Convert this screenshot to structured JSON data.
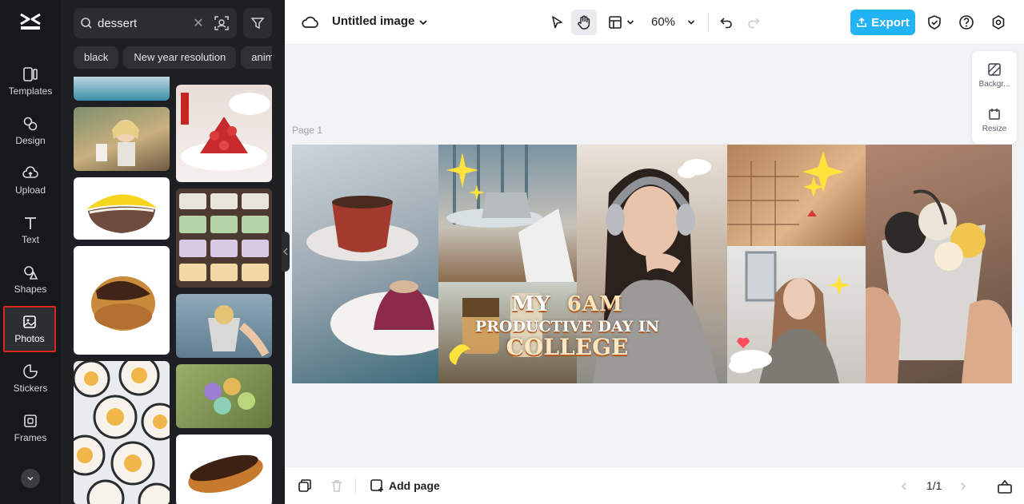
{
  "sidebar": {
    "items": [
      {
        "label": "Templates",
        "icon": "templates-icon"
      },
      {
        "label": "Design",
        "icon": "design-icon"
      },
      {
        "label": "Upload",
        "icon": "upload-icon"
      },
      {
        "label": "Text",
        "icon": "text-icon"
      },
      {
        "label": "Shapes",
        "icon": "shapes-icon"
      },
      {
        "label": "Photos",
        "icon": "photos-icon",
        "active": true
      },
      {
        "label": "Stickers",
        "icon": "stickers-icon"
      },
      {
        "label": "Frames",
        "icon": "frames-icon"
      }
    ]
  },
  "panel": {
    "search": {
      "value": "dessert"
    },
    "chips": [
      "black",
      "New year resolution",
      "anim"
    ]
  },
  "topbar": {
    "doc_title": "Untitled image",
    "zoom": "60%",
    "export_label": "Export"
  },
  "canvas": {
    "page_label": "Page 1",
    "headline": {
      "line1_a": "MY",
      "line1_b": "6AM",
      "line2": "PRODUCTIVE DAY IN",
      "line3": "COLLEGE"
    }
  },
  "side_tools": {
    "background_label": "Backgr...",
    "resize_label": "Resize"
  },
  "bottombar": {
    "add_page_label": "Add page",
    "pager": "1/1"
  },
  "colors": {
    "accent": "#21b3f3",
    "active_outline": "#e02424",
    "rail_bg": "#17181b",
    "panel_bg": "#1e1f22"
  }
}
